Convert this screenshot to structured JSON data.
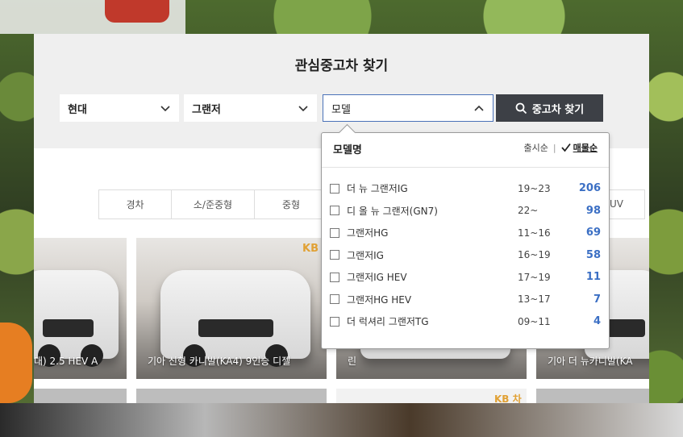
{
  "search": {
    "title": "관심중고차 찾기",
    "maker": "현대",
    "model": "그랜저",
    "sub_model_placeholder": "모델",
    "button_label": "중고차 찾기"
  },
  "tabs": [
    "경차",
    "소/준중형",
    "중형",
    "UV"
  ],
  "cards": [
    {
      "caption": "대) 2.5 HEV A"
    },
    {
      "caption": "기아 신형 카니발(KA4) 9인승 디젤"
    },
    {
      "caption": "린"
    },
    {
      "caption": "기아 더 뉴카니발(KA"
    }
  ],
  "card_badges": {
    "kb": "KB",
    "kb2": "KB 차"
  },
  "dropdown": {
    "title": "모델명",
    "sort_release": "출시순",
    "sort_count": "매물순",
    "items": [
      {
        "name": "더 뉴 그랜저IG",
        "years": "19~23",
        "count": "206"
      },
      {
        "name": "디 올 뉴 그랜저(GN7)",
        "years": "22~",
        "count": "98"
      },
      {
        "name": "그랜저HG",
        "years": "11~16",
        "count": "69"
      },
      {
        "name": "그랜저IG",
        "years": "16~19",
        "count": "58"
      },
      {
        "name": "그랜저IG HEV",
        "years": "17~19",
        "count": "11"
      },
      {
        "name": "그랜저HG HEV",
        "years": "13~17",
        "count": "7"
      },
      {
        "name": "더 럭셔리 그랜저TG",
        "years": "09~11",
        "count": "4"
      }
    ]
  },
  "colors": {
    "accent": "#3b6fc4",
    "button": "#3d4046",
    "head_bg": "#efefef"
  }
}
